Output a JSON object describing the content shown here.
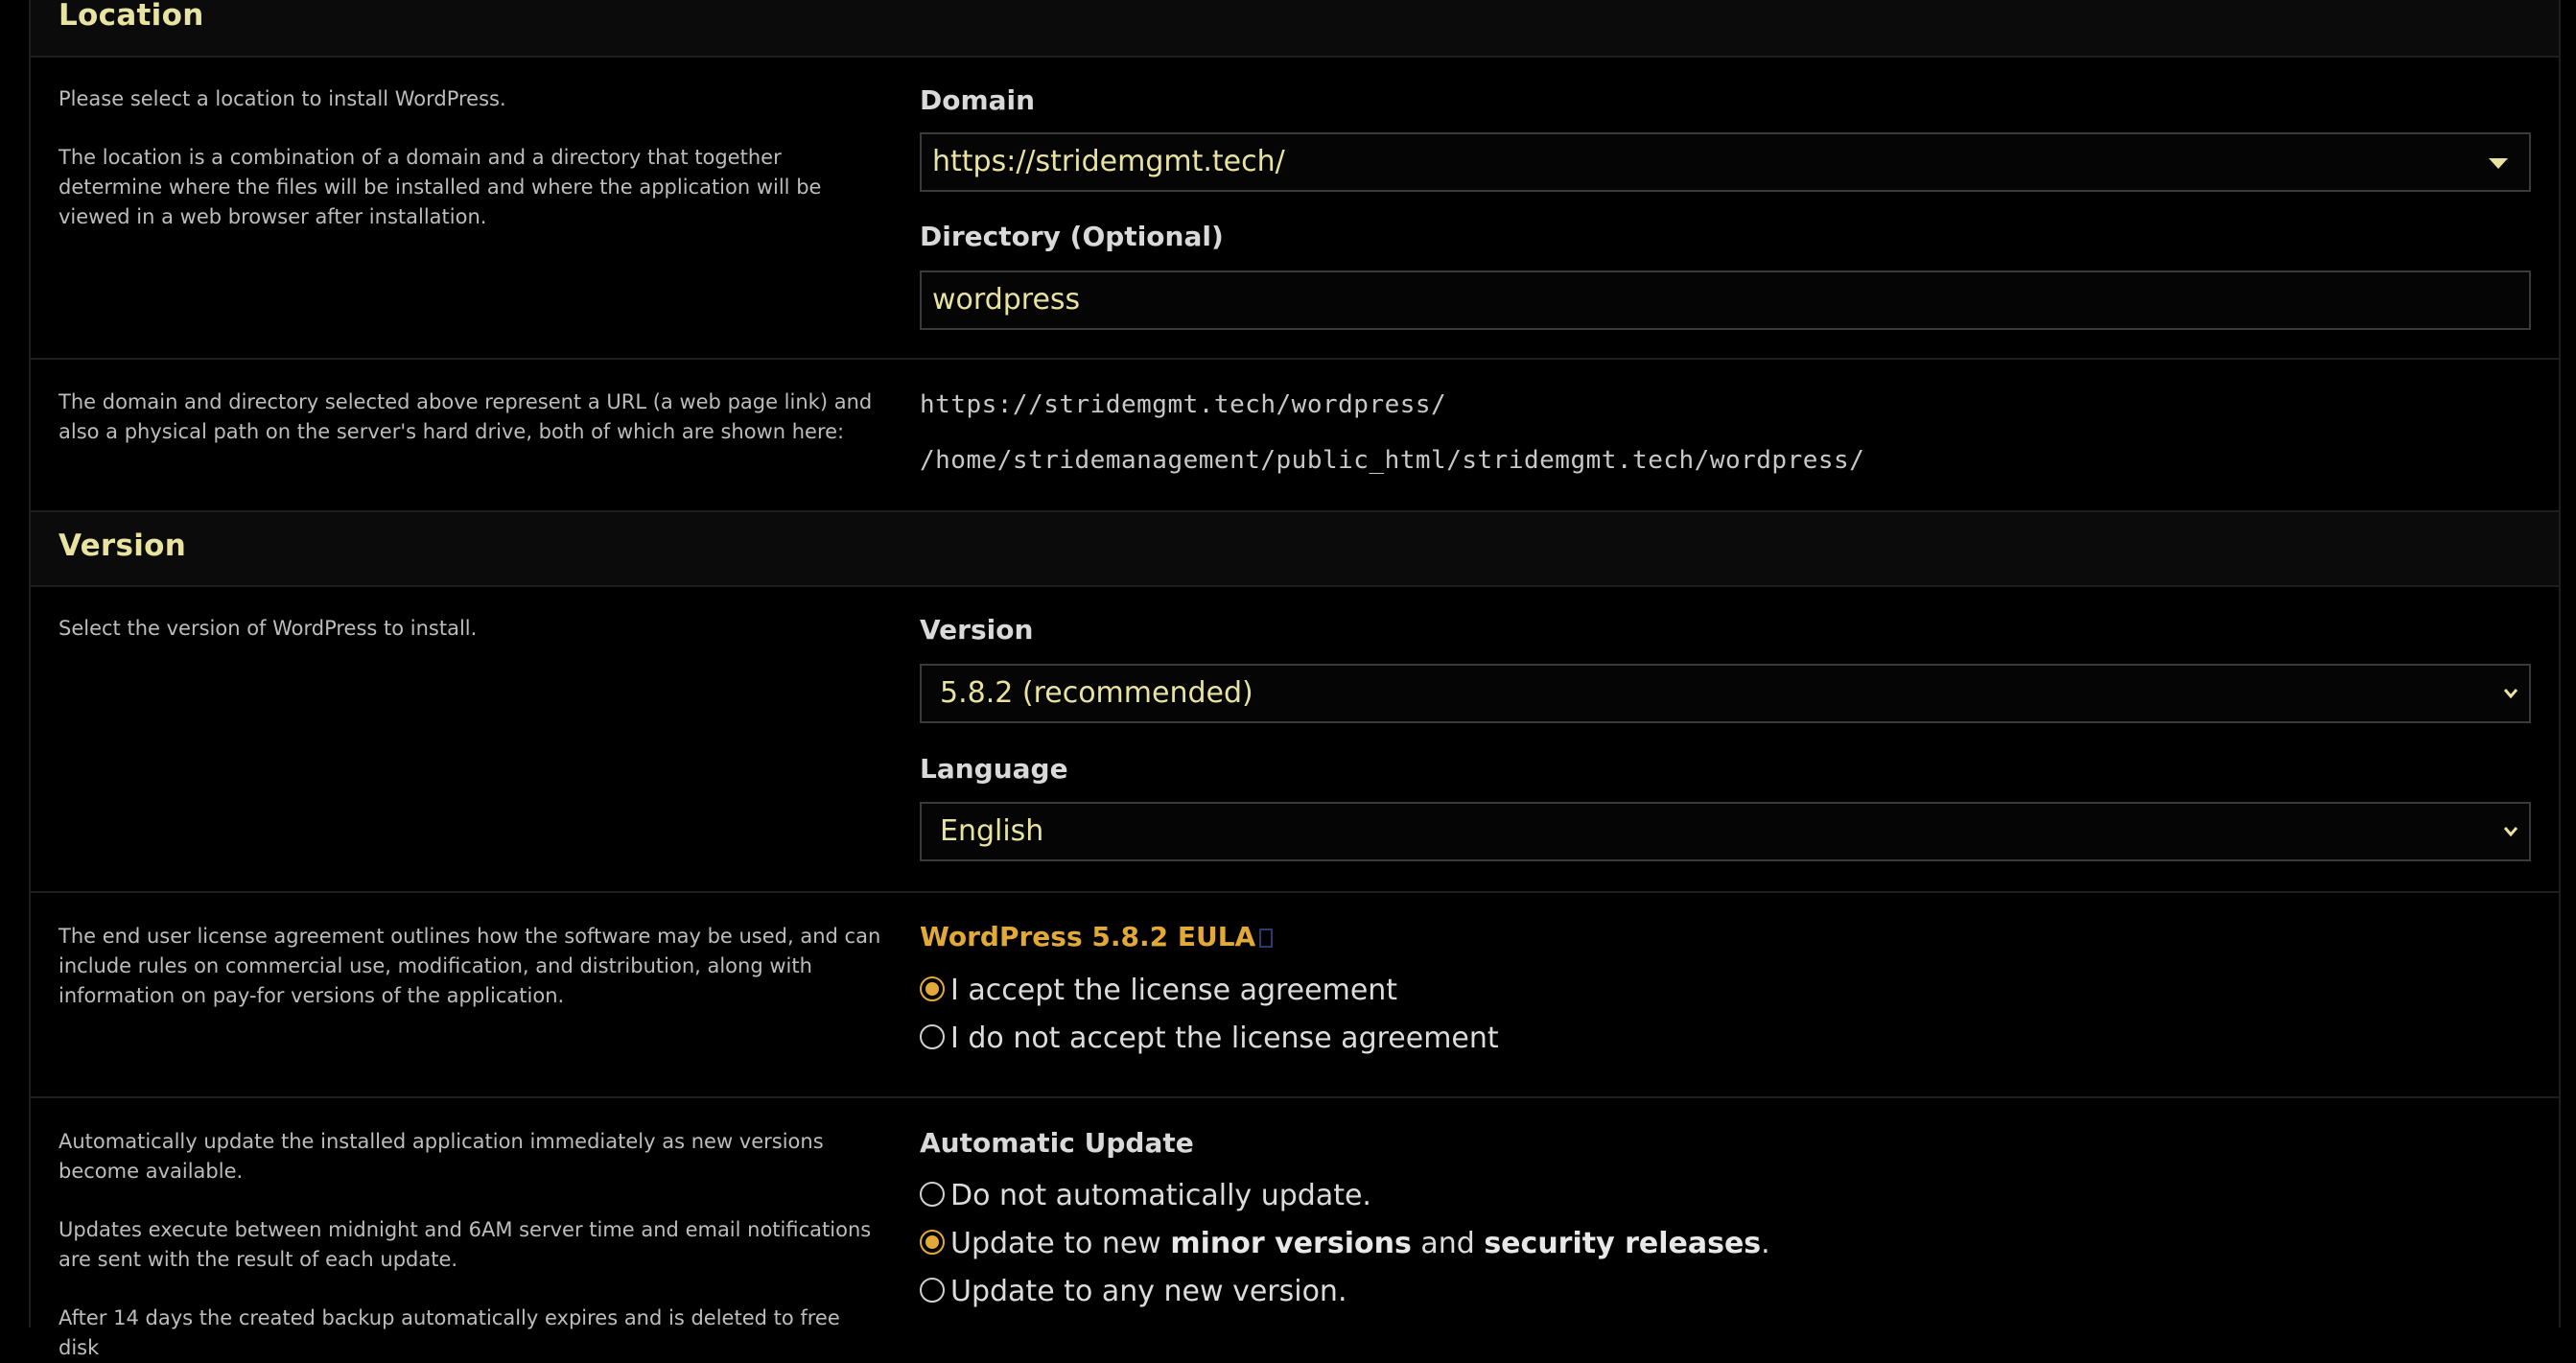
{
  "location": {
    "heading": "Location",
    "help_p1": "Please select a location to install WordPress.",
    "help_p2": "The location is a combination of a domain and a directory that together determine where the files will be installed and where the application will be viewed in a web browser after installation.",
    "domain_label": "Domain",
    "domain_value": "https://stridemgmt.tech/",
    "directory_label": "Directory (Optional)",
    "directory_value": "wordpress",
    "path_help": "The domain and directory selected above represent a URL (a web page link) and also a physical path on the server's hard drive, both of which are shown here:",
    "url": "https://stridemgmt.tech/wordpress/",
    "path": "/home/stridemanagement/public_html/stridemgmt.tech/wordpress/"
  },
  "version": {
    "heading": "Version",
    "help": "Select the version of WordPress to install.",
    "version_label": "Version",
    "version_selected": "5.8.2 (recommended)",
    "language_label": "Language",
    "language_selected": "English"
  },
  "eula": {
    "help": "The end user license agreement outlines how the software may be used, and can include rules on commercial use, modification, and distribution, along with information on pay-for versions of the application.",
    "link_text": "WordPress 5.8.2 EULA",
    "accept_label": "I accept the license agreement",
    "decline_label": "I do not accept the license agreement"
  },
  "auto_update": {
    "help_p1": "Automatically update the installed application immediately as new versions become available.",
    "help_p2": "Updates execute between midnight and 6AM server time and email notifications are sent with the result of each update.",
    "help_p3": "After 14 days the created backup automatically expires and is deleted to free disk",
    "label": "Automatic Update",
    "opt_none": "Do not automatically update.",
    "opt_minor_prefix": "Update to new ",
    "opt_minor_b1": "minor versions",
    "opt_minor_mid": " and ",
    "opt_minor_b2": "security releases",
    "opt_minor_suffix": ".",
    "opt_any": "Update to any new version."
  },
  "colors": {
    "accent": "#e2a938",
    "value_text": "#e8e3a0",
    "background": "#000000"
  }
}
